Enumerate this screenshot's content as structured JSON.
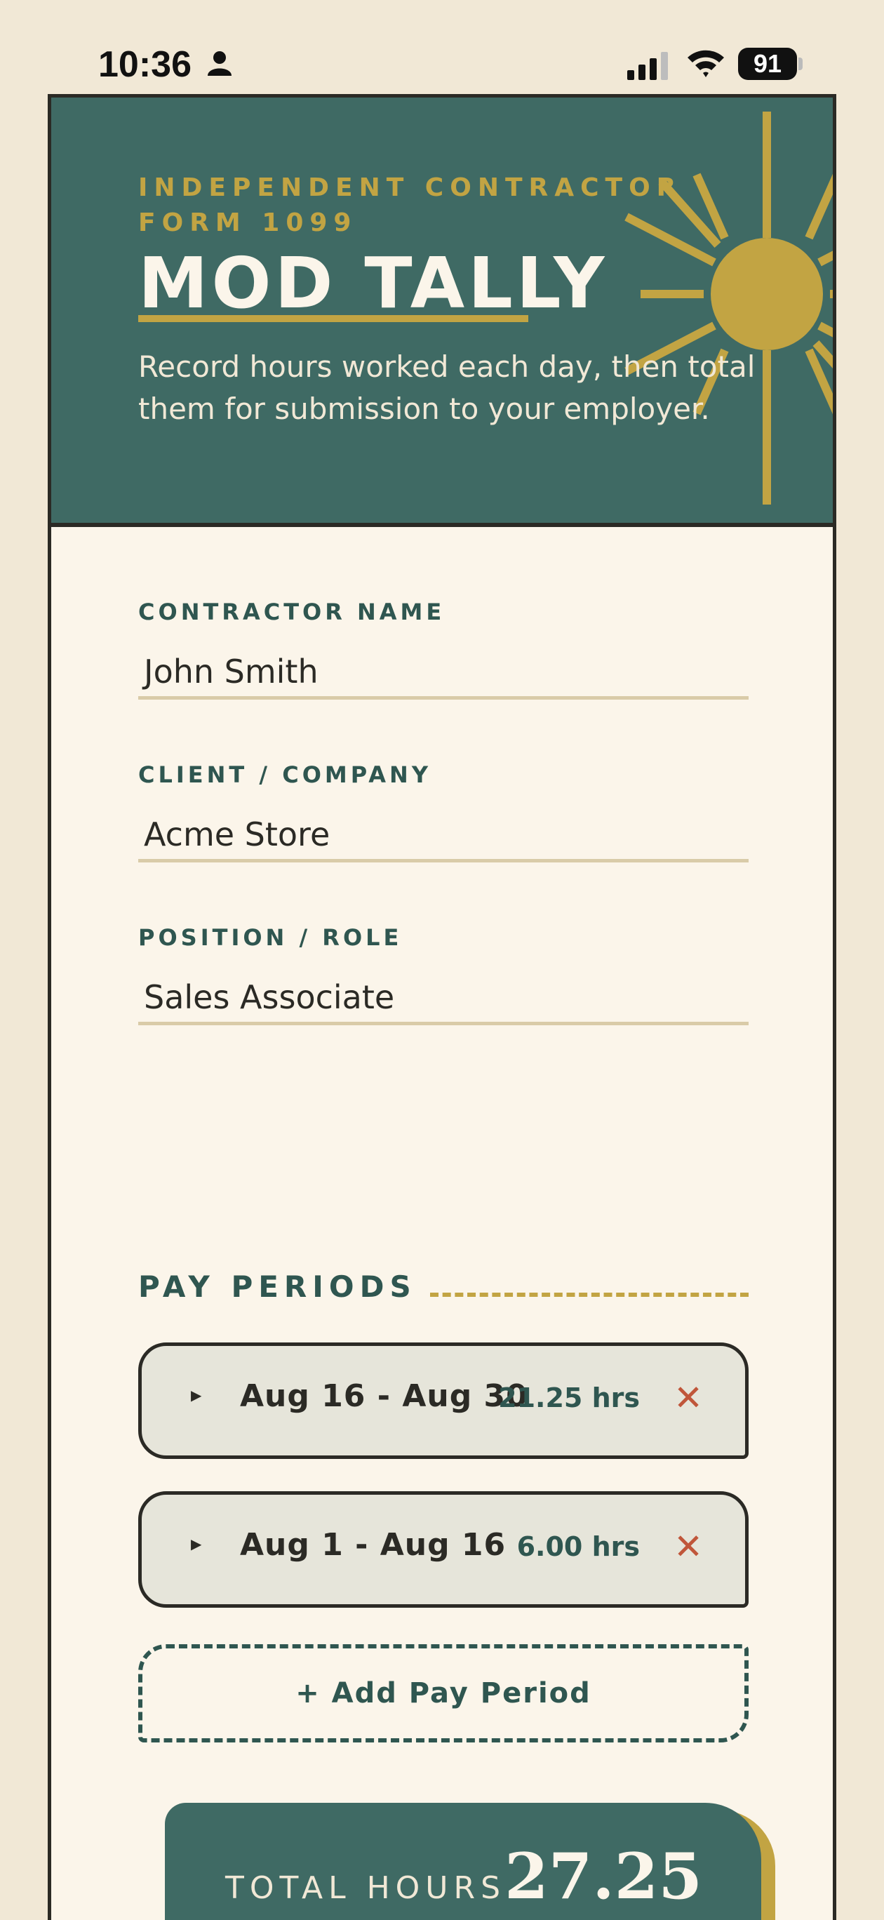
{
  "status_bar": {
    "time": "10:36",
    "battery": "91",
    "icons": [
      "person-icon",
      "cellular-signal-icon",
      "wifi-icon",
      "battery-icon"
    ]
  },
  "header": {
    "eyebrow": "INDEPENDENT CONTRACTOR FORM 1099",
    "title": "MOD TALLY",
    "subtitle": "Record hours worked each day, then total them for submission to your employer."
  },
  "form": {
    "contractor_name": {
      "label": "CONTRACTOR NAME",
      "value": "John Smith"
    },
    "client": {
      "label": "CLIENT / COMPANY",
      "value": "Acme Store"
    },
    "position": {
      "label": "POSITION / ROLE",
      "value": "Sales Associate"
    }
  },
  "pay_periods": {
    "title": "PAY PERIODS",
    "items": [
      {
        "range": "Aug 16 - Aug 30",
        "hours": "21.25 hrs"
      },
      {
        "range": "Aug 1 - Aug 16",
        "hours": "6.00 hrs"
      }
    ],
    "add_label": "+ Add Pay Period"
  },
  "total": {
    "label": "TOTAL HOURS",
    "value": "27.25"
  },
  "colors": {
    "teal": "#3f6a64",
    "gold": "#c2a443",
    "cream": "#fbf5ea",
    "remove_red": "#c0563a"
  }
}
